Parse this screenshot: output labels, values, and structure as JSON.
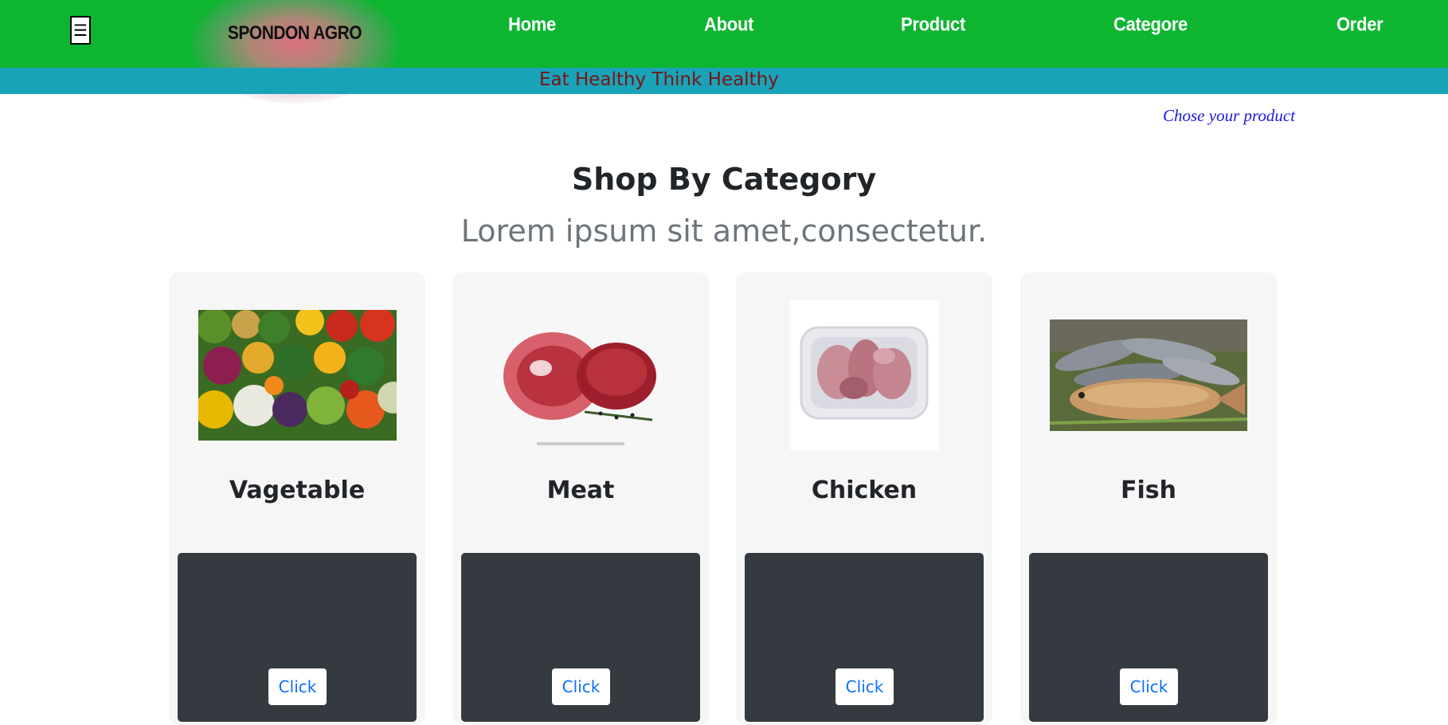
{
  "header": {
    "menu_glyph": "☰",
    "logo": "SPONDON AGRO",
    "nav": [
      "Home",
      "About",
      "Product",
      "Categore",
      "Order"
    ],
    "tagline": "Eat Healthy Think Healthy",
    "chose_link": "Chose your product",
    "colors": {
      "navbar": "#0db531",
      "subbar": "#19a3b8",
      "tagline": "#7a1414"
    }
  },
  "section": {
    "title": "Shop By Category",
    "subtitle": "Lorem ipsum sit amet,consectetur."
  },
  "cards": [
    {
      "title": "Vagetable",
      "button": "Click",
      "image": "vegetables-photo"
    },
    {
      "title": "Meat",
      "button": "Click",
      "image": "meat-photo"
    },
    {
      "title": "Chicken",
      "button": "Click",
      "image": "chicken-tray-photo"
    },
    {
      "title": "Fish",
      "button": "Click",
      "image": "fish-photo"
    }
  ]
}
